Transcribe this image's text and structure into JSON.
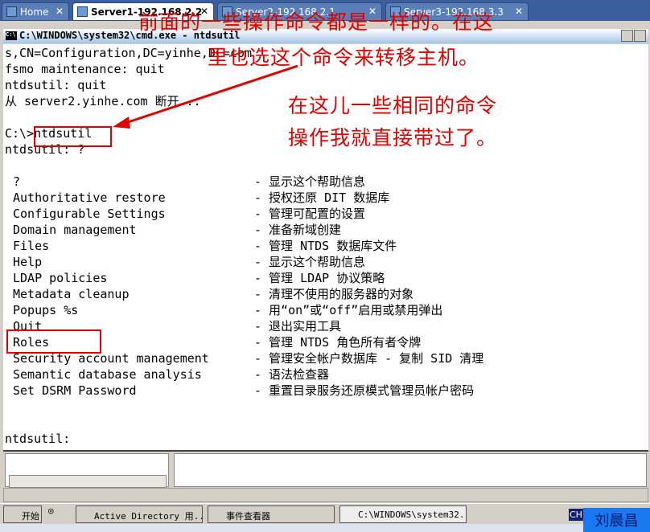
{
  "tabs": [
    {
      "label": "Home"
    },
    {
      "label": "Server1-192.168.2.2"
    },
    {
      "label": "Server2-192.168.2.1"
    },
    {
      "label": "Server3-192.168.3.3"
    }
  ],
  "window": {
    "title": "C:\\WINDOWS\\system32\\cmd.exe - ntdsutil",
    "icon": "cmd-icon"
  },
  "console": {
    "pre_lines": [
      "s,CN=Configuration,DC=yinhe,DC=com",
      "fsmo maintenance: quit",
      "ntdsutil: quit",
      "从 server2.yinhe.com 断开...",
      "",
      "C:\\>ntdsutil",
      "ntdsutil: ?"
    ],
    "help": [
      {
        "cmd": "?",
        "desc": "- 显示这个帮助信息"
      },
      {
        "cmd": "Authoritative restore",
        "desc": "- 授权还原 DIT 数据库"
      },
      {
        "cmd": "Configurable Settings",
        "desc": "- 管理可配置的设置"
      },
      {
        "cmd": "Domain management",
        "desc": "- 准备新域创建"
      },
      {
        "cmd": "Files",
        "desc": "- 管理 NTDS 数据库文件"
      },
      {
        "cmd": "Help",
        "desc": "- 显示这个帮助信息"
      },
      {
        "cmd": "LDAP policies",
        "desc": "- 管理 LDAP 协议策略"
      },
      {
        "cmd": "Metadata cleanup",
        "desc": "- 清理不使用的服务器的对象"
      },
      {
        "cmd": "Popups %s",
        "desc": "- 用“on”或“off”启用或禁用弹出"
      },
      {
        "cmd": "Quit",
        "desc": "- 退出实用工具"
      },
      {
        "cmd": "Roles",
        "desc": "- 管理 NTDS 角色所有者令牌"
      },
      {
        "cmd": "Security account management",
        "desc": "- 管理安全帐户数据库 - 复制 SID 清理"
      },
      {
        "cmd": "Semantic database analysis",
        "desc": "- 语法检查器"
      },
      {
        "cmd": "Set DSRM Password",
        "desc": "- 重置目录服务还原模式管理员帐户密码"
      }
    ],
    "prompt": "ntdsutil:"
  },
  "annotations": {
    "line1": "前面的一些操作命令都是一样的。在这",
    "line2": "里也选这个命令来转移主机。",
    "line3": "在这儿一些相同的命令",
    "line4": "操作我就直接带过了。",
    "color": "#e00000"
  },
  "taskbar": {
    "start": "开始",
    "items": [
      {
        "label": "Active Directory 用..."
      },
      {
        "label": "事件查看器"
      },
      {
        "label": "C:\\WINDOWS\\system32..."
      }
    ],
    "lang": "CH",
    "user": "刘晨昌"
  }
}
